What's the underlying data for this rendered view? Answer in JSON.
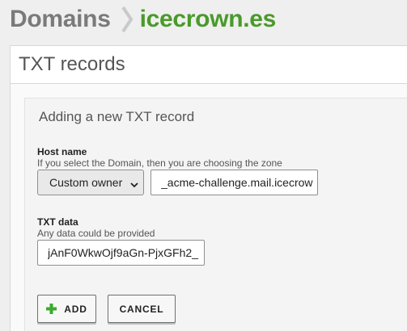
{
  "breadcrumb": {
    "root": "Domains",
    "current": "icecrown.es"
  },
  "panel": {
    "title": "TXT records"
  },
  "form": {
    "title": "Adding a new TXT record",
    "host": {
      "label": "Host name",
      "help": "If you select the Domain, then you are choosing the zone",
      "owner_select": "Custom owner",
      "value": "_acme-challenge.mail.icecrow"
    },
    "txt": {
      "label": "TXT data",
      "help": "Any data could be provided",
      "value": "jAnF0WkwOjf9aGn-PjxGFh2_"
    },
    "buttons": {
      "add": "ADD",
      "cancel": "CANCEL"
    }
  },
  "colors": {
    "accent_green": "#4a9a2b",
    "plus_icon": "#3aab2e",
    "breadcrumb_gray": "#7a7a7a"
  },
  "icons": {
    "separator": "chevron-right-icon",
    "select_caret": "chevron-down-icon",
    "add": "plus-icon"
  }
}
